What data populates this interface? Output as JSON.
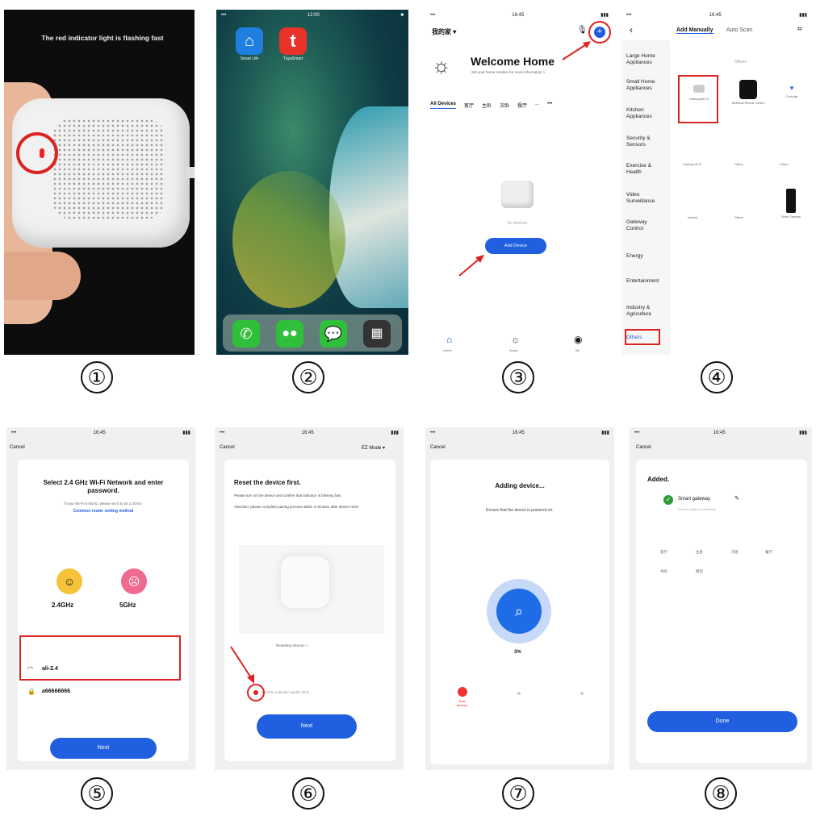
{
  "panel1": {
    "caption": "The red indicator light is flashing fast"
  },
  "panel2": {
    "apps": [
      "Smart Life",
      "TuyaSmart"
    ]
  },
  "panel3": {
    "home": "我的家 ▾",
    "title": "Welcome Home",
    "subtitle": "Set your home location for more information >",
    "tabs": [
      "All Devices",
      "客厅",
      "主卧",
      "次卧",
      "餐厅",
      "...",
      "•••"
    ],
    "no_devices": "No devices",
    "add_device": "Add Device",
    "nav": [
      "Home",
      "Smart",
      "Me"
    ]
  },
  "panel4": {
    "tab_manual": "Add Manually",
    "tab_auto": "Auto Scan",
    "categories": [
      "Large Home Appliances",
      "Small Home Appliances",
      "Kitchen Appliances",
      "Security & Sensors",
      "Exercise & Health",
      "Video Surveillance",
      "Gateway Control",
      "Energy",
      "Entertainment",
      "Industry & Agriculture",
      "Others"
    ],
    "section": "Others",
    "devices": [
      "Gateway(Wi-Fi)",
      "Bluetooth Remote Control",
      "Controller",
      "Gateway Wi-Fi",
      "Others",
      "Others",
      "Infrared",
      "Others",
      "Smart Gateway"
    ]
  },
  "panel5": {
    "cancel": "Cancel",
    "title": "Select 2.4 GHz Wi-Fi Network and enter password.",
    "note": "If your Wi-Fi is 5GHz, please set it to be 2.4GHz.",
    "link": "Common router setting method",
    "band1": "2.4GHz",
    "band2": "5GHz",
    "ssid": "ali-2.4",
    "password": "a66666666",
    "next": "Next"
  },
  "panel6": {
    "cancel": "Cancel",
    "mode": "EZ Mode ▾",
    "title": "Reset the device first.",
    "desc1": "Please turn on the device and confirm that indicator is blinking fast",
    "desc2": "Attention: please complete pairing process within 3 minutes after device reset",
    "resetting": "Resetting devices >",
    "confirm": "Confirm indicator rapidly blink",
    "next": "Next"
  },
  "panel7": {
    "cancel": "Cancel",
    "title": "Adding device...",
    "subtitle": "Ensure that the device is powered on.",
    "percent": "3%",
    "step": "Scan devices."
  },
  "panel8": {
    "cancel": "Cancel",
    "title": "Added.",
    "device": "Smart gateway",
    "added_ok": "Device added successfully",
    "rooms": [
      "客厅",
      "主卧",
      "次卧",
      "餐厅",
      "书房",
      "厨房"
    ],
    "done": "Done"
  },
  "steps": [
    "①",
    "②",
    "③",
    "④",
    "⑤",
    "⑥",
    "⑦",
    "⑧"
  ],
  "colors": {
    "accent": "#1f5fe0",
    "red": "#d22222",
    "green": "#2f9a3a"
  }
}
